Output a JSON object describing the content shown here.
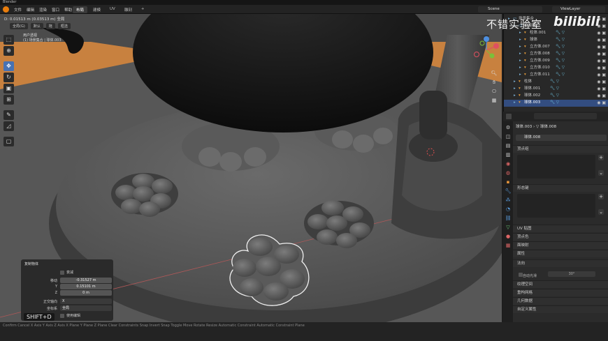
{
  "app": {
    "title": "Blender"
  },
  "menu": [
    "文件",
    "编辑",
    "渲染",
    "窗口",
    "帮助"
  ],
  "workspace_tabs": [
    {
      "label": "布局",
      "active": true
    },
    {
      "label": "建模",
      "active": false
    },
    {
      "label": "UV",
      "active": false
    },
    {
      "label": "雕刻",
      "active": false
    },
    {
      "label": "+",
      "active": false
    }
  ],
  "scene": {
    "name": "Scene"
  },
  "view_layer": {
    "name": "ViewLayer"
  },
  "viewport": {
    "coords": "D: 0.01513 m (0.03513 m) 全局",
    "mode_label": "全局(G)",
    "orientation": "默认",
    "snap_label": "拖",
    "select_label": "框选",
    "view_name": "用户透视",
    "collection_info": "(1) 场景集合 | 球体.003"
  },
  "watermark": {
    "left": "不错实验室",
    "right": "bilibili"
  },
  "operator_panel": {
    "title": "复制物体",
    "proportional_label": "衰减",
    "move_label": "移动",
    "x_value": "-0.31527 m",
    "y_label": "Y",
    "y_value": "0.15101 m",
    "z_label": "Z",
    "z_value": "0 m",
    "orientation_label": "正交轴向",
    "orientation_value": "X",
    "coord_label": "坐标系",
    "coord_value": "全局",
    "edit_label": "使用编辑"
  },
  "shortcut_overlay": "SHIFT+D",
  "statusbar": {
    "text": "Confirm   Cancel   X Axis   Y Axis   Z Axis   X Plane   Y Plane   Z Plane   Clear Constraints   Snap Invert   Snap Toggle   Move   Rotate   Resize   Automatic Constraint   Automatic Constraint Plane"
  },
  "outliner": {
    "rows": [
      {
        "name": "场景集合",
        "indent": 0,
        "type": "collection",
        "selected": false
      },
      {
        "name": "拍摄集",
        "indent": 1,
        "type": "collection",
        "selected": false
      },
      {
        "name": "柱体.001",
        "indent": 2,
        "type": "mesh",
        "selected": false
      },
      {
        "name": "球体",
        "indent": 2,
        "type": "mesh",
        "selected": false
      },
      {
        "name": "立方体.007",
        "indent": 2,
        "type": "mesh",
        "selected": false
      },
      {
        "name": "立方体.008",
        "indent": 2,
        "type": "mesh",
        "selected": false
      },
      {
        "name": "立方体.009",
        "indent": 2,
        "type": "mesh",
        "selected": false
      },
      {
        "name": "立方体.010",
        "indent": 2,
        "type": "mesh",
        "selected": false
      },
      {
        "name": "立方体.011",
        "indent": 2,
        "type": "mesh",
        "selected": false
      },
      {
        "name": "柱体",
        "indent": 1,
        "type": "mesh",
        "selected": false
      },
      {
        "name": "球体.001",
        "indent": 1,
        "type": "mesh",
        "selected": false
      },
      {
        "name": "球体.002",
        "indent": 1,
        "type": "mesh",
        "selected": false
      },
      {
        "name": "球体.003",
        "indent": 1,
        "type": "mesh",
        "selected": true
      }
    ]
  },
  "properties": {
    "breadcrumb_object": "球体.003",
    "breadcrumb_mesh": "球体.008",
    "mesh_name": "球体.008",
    "sections": [
      "顶点组",
      "形态键",
      "UV 贴图",
      "顶点色",
      "面映射",
      "属性",
      "法向",
      "纹理空间",
      "重构网格",
      "几何数据",
      "自定义属性"
    ],
    "auto_smooth_label": "自动光滑",
    "auto_smooth_value": "30°"
  }
}
